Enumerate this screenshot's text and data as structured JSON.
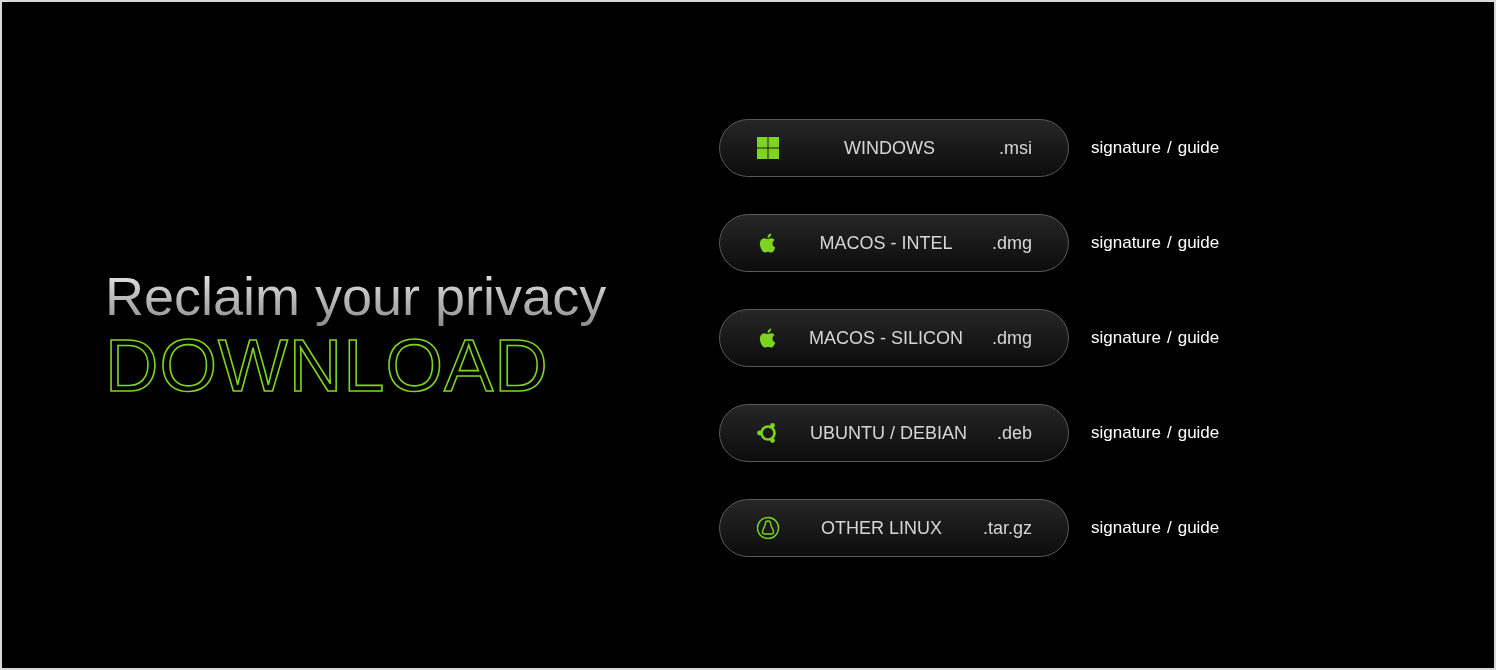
{
  "hero": {
    "tagline": "Reclaim your privacy",
    "title": "DOWNLOAD"
  },
  "downloads": [
    {
      "kind": "windows",
      "label": "WINDOWS",
      "extension": ".msi",
      "links": [
        "signature",
        "/",
        "guide"
      ]
    },
    {
      "kind": "apple",
      "label": "MACOS - INTEL",
      "extension": ".dmg",
      "links": [
        "signature",
        "/",
        "guide"
      ]
    },
    {
      "kind": "apple",
      "label": "MACOS - SILICON",
      "extension": ".dmg",
      "links": [
        "signature",
        "/",
        "guide"
      ]
    },
    {
      "kind": "ubuntu",
      "label": "UBUNTU / DEBIAN",
      "extension": ".deb",
      "links": [
        "signature",
        "/",
        "guide"
      ]
    },
    {
      "kind": "linux",
      "label": "OTHER LINUX",
      "extension": ".tar.gz",
      "links": [
        "signature",
        "/",
        "guide"
      ]
    }
  ]
}
